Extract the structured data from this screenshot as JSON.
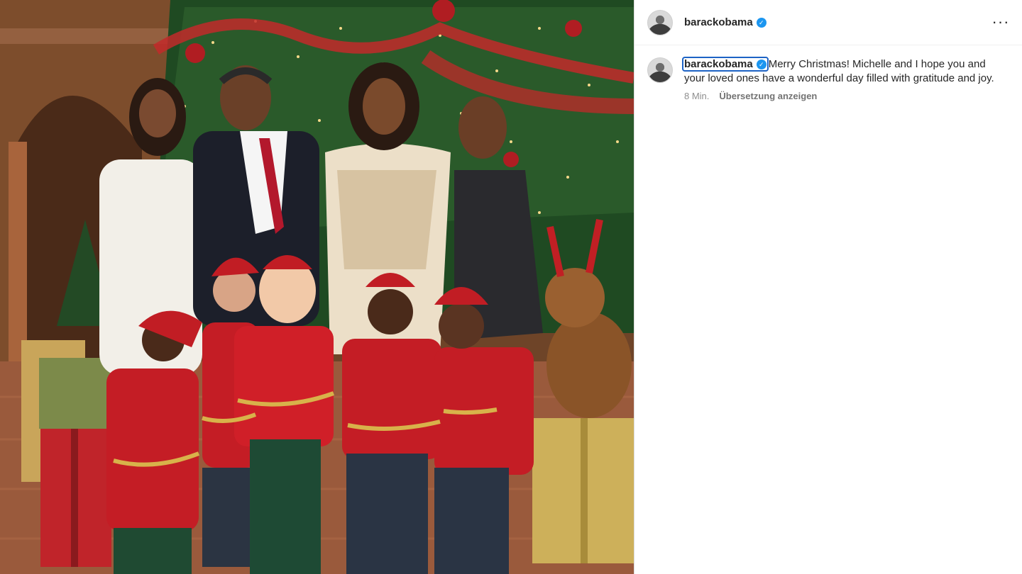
{
  "post": {
    "username": "barackobama",
    "verified": true,
    "colors": {
      "verified_badge": "#1c96f0",
      "focus_ring": "#1d63c5",
      "meta_text": "#8e8e8e"
    },
    "photo": {
      "icon": "photo-image"
    }
  },
  "header": {
    "username": "barackobama",
    "more_icon": "more-horizontal-icon"
  },
  "caption": {
    "username": "barackobama",
    "text": "Merry Christmas! Michelle and I hope you and your loved ones have a wonderful day filled with gratitude and joy.",
    "time": "8 Min.",
    "translate_label": "Übersetzung anzeigen"
  }
}
